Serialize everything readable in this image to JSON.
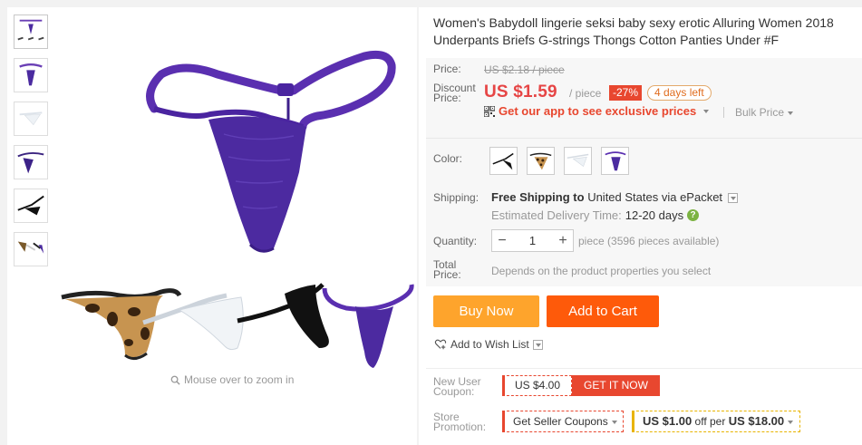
{
  "product": {
    "title": "Women's Babydoll lingerie seksi baby sexy erotic Alluring Women 2018 Underpants Briefs G-strings Thongs Cotton Panties Under #F"
  },
  "gallery": {
    "zoom_hint": "Mouse over to zoom in",
    "thumb_icon": "product-thumbnail",
    "zoom_icon": "magnifier-icon"
  },
  "price": {
    "price_label": "Price:",
    "original": "US $2.18 / piece",
    "discount_label": "Discount Price:",
    "discount_label_line1": "Discount",
    "discount_label_line2": "Price:",
    "current": "US $1.59",
    "unit": "/ piece",
    "discount_pct": "-27%",
    "days_left": "4 days left",
    "app_promo": "Get our app to see exclusive prices",
    "bulk_price": "Bulk Price",
    "accent_color": "#e64545"
  },
  "options": {
    "color_label": "Color:",
    "shipping_label": "Shipping:",
    "shipping_free": "Free Shipping to",
    "shipping_rest": "United States via ePacket",
    "delivery_label": "Estimated Delivery Time:",
    "delivery_days": "12-20 days",
    "quantity_label": "Quantity:",
    "quantity_value": "1",
    "quantity_avail": "piece (3596 pieces available)",
    "total_label_line1": "Total",
    "total_label_line2": "Price:",
    "total_note": "Depends on the product properties you select"
  },
  "actions": {
    "buy_now": "Buy Now",
    "add_to_cart": "Add to Cart",
    "wish_list": "Add to Wish List",
    "buy_color": "#fea42c",
    "cart_color": "#fe5a0a"
  },
  "coupons": {
    "new_user_line1": "New User",
    "new_user_line2": "Coupon:",
    "coupon_value": "US $4.00",
    "get_it_now": "GET IT NOW",
    "store_line1": "Store",
    "store_line2": "Promotion:",
    "seller_coupons": "Get Seller Coupons",
    "promo_off": "US $1.00",
    "promo_off_text": "off per",
    "promo_threshold": "US $18.00"
  }
}
